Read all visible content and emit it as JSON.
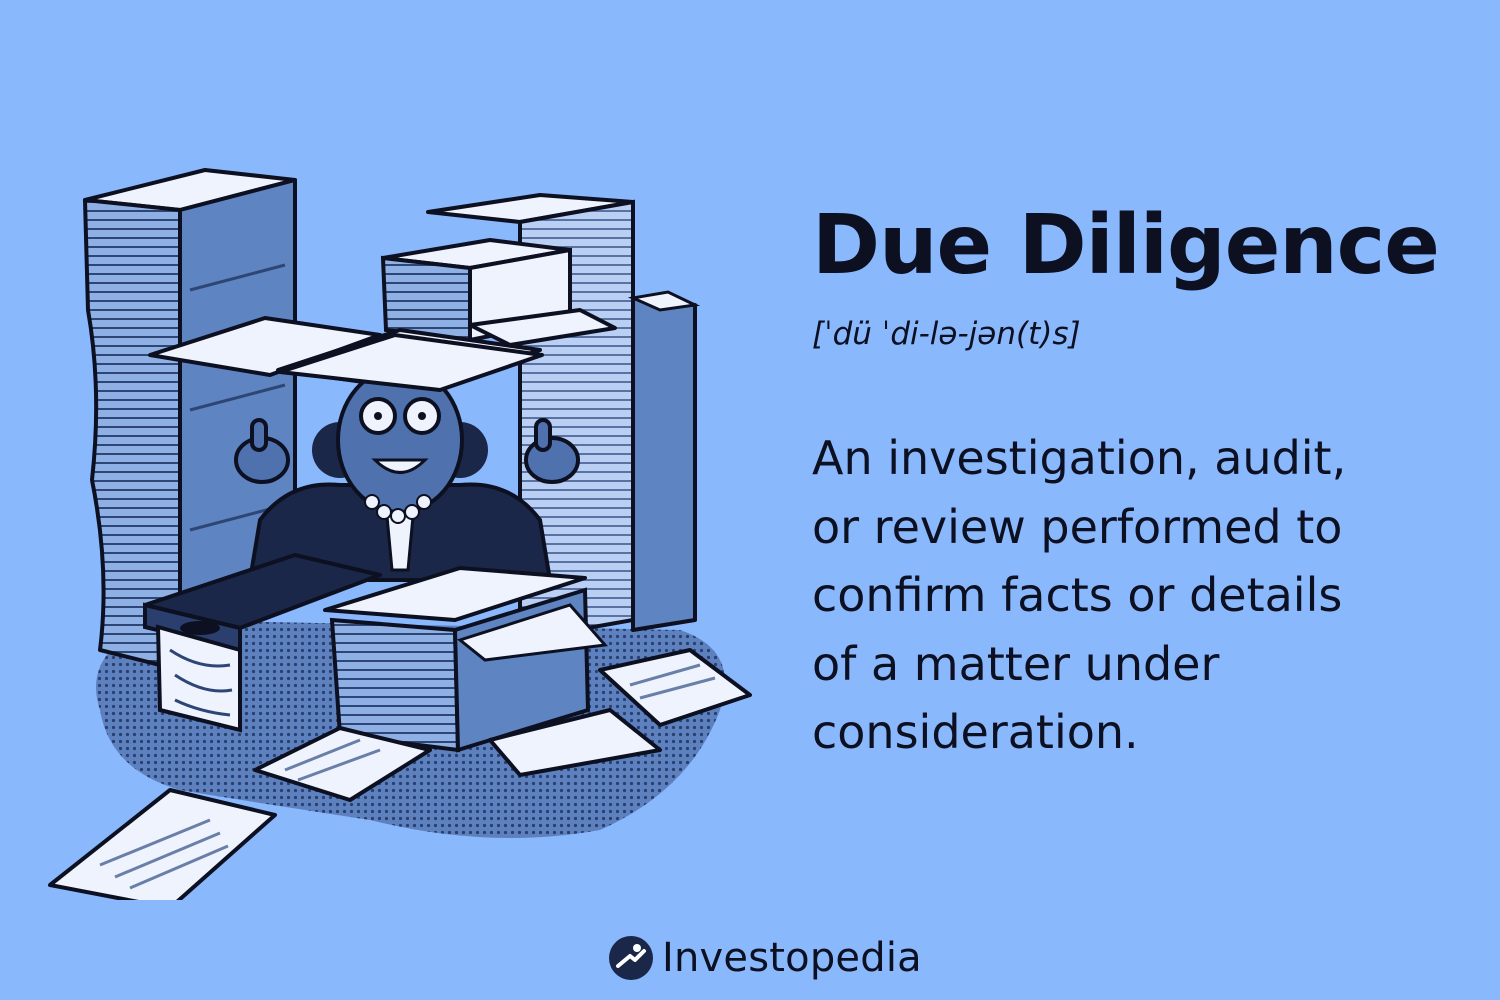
{
  "term": {
    "title": "Due Diligence",
    "pronunciation": "[ˈdü ˈdi-lə-jən(t)s]"
  },
  "definition": {
    "lines": [
      "An investigation, audit,",
      "or review performed to",
      "confirm facts or details",
      "of a matter under",
      "consideration."
    ]
  },
  "brand": {
    "name": "Investopedia",
    "logo_icon": "investopedia-logo-icon"
  },
  "colors": {
    "background": "#8ab8fd",
    "text": "#0c1021",
    "paper_blue": "#6e90c8",
    "paper_light": "#eaf1fd",
    "outline": "#0c1021"
  }
}
